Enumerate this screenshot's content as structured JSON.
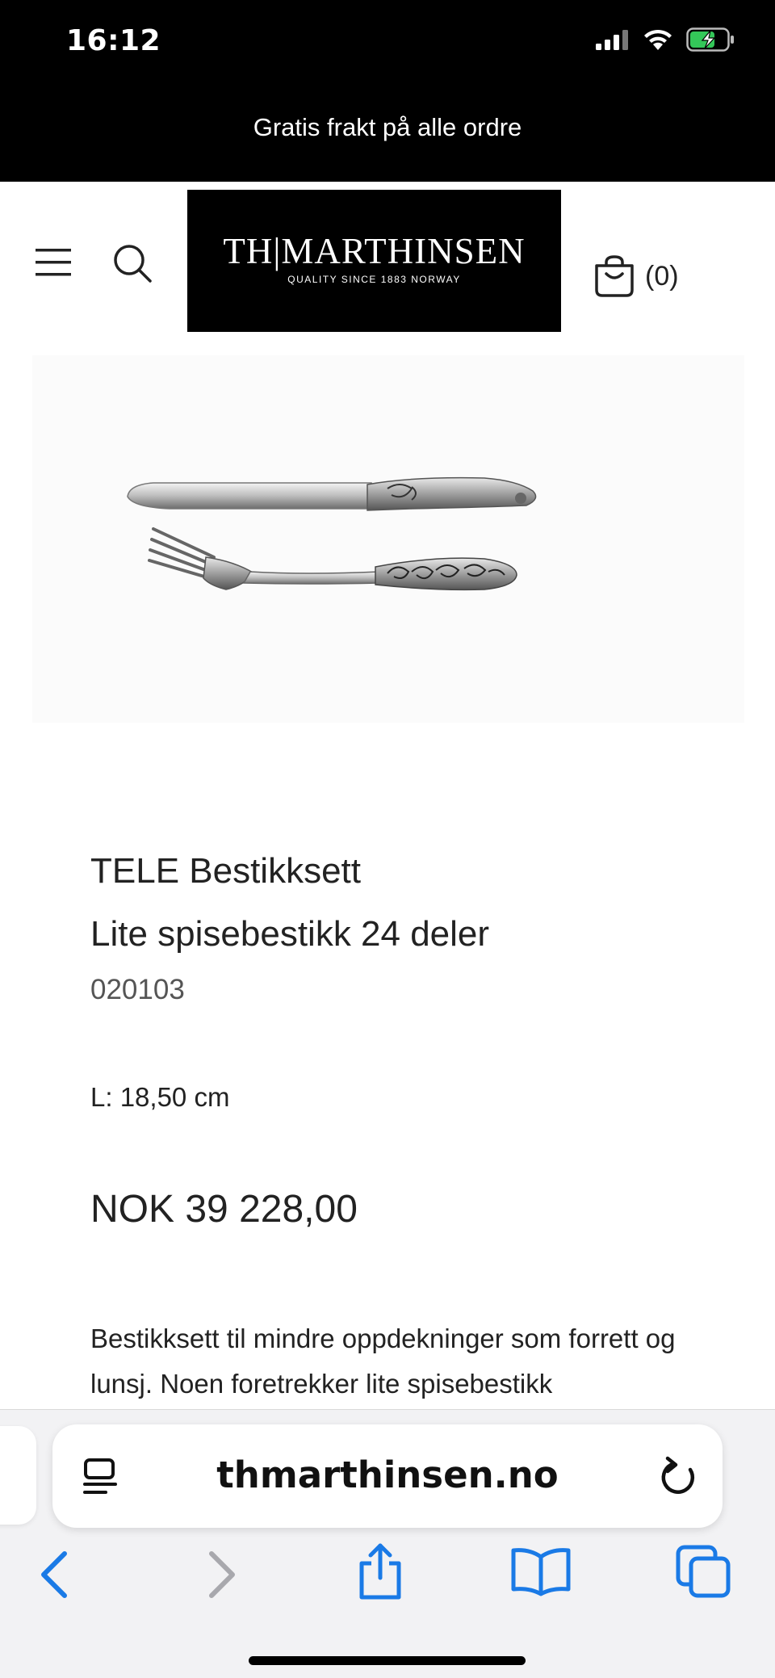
{
  "status_bar": {
    "time": "16:12"
  },
  "announcement": {
    "text": "Gratis frakt på alle ordre"
  },
  "header": {
    "logo_main": "TH|MARTHINSEN",
    "logo_sub": "QUALITY SINCE 1883   NORWAY",
    "cart_count": "(0)",
    "icons": [
      "menu-icon",
      "search-icon",
      "shopping-bag-icon"
    ]
  },
  "product": {
    "title_line1": "TELE Bestikksett",
    "title_line2": "Lite spisebestikk 24 deler",
    "sku": "020103",
    "length": "L: 18,50 cm",
    "price": "NOK 39 228,00",
    "description": "Bestikksett til mindre oppdekninger som forrett og lunsj. Noen foretrekker lite spisebestikk"
  },
  "browser": {
    "url": "thmarthinsen.no",
    "accent_color": "#1a7ae6",
    "toolbar_icons": [
      "back-icon",
      "forward-icon",
      "share-icon",
      "bookmarks-icon",
      "tabs-icon"
    ]
  }
}
